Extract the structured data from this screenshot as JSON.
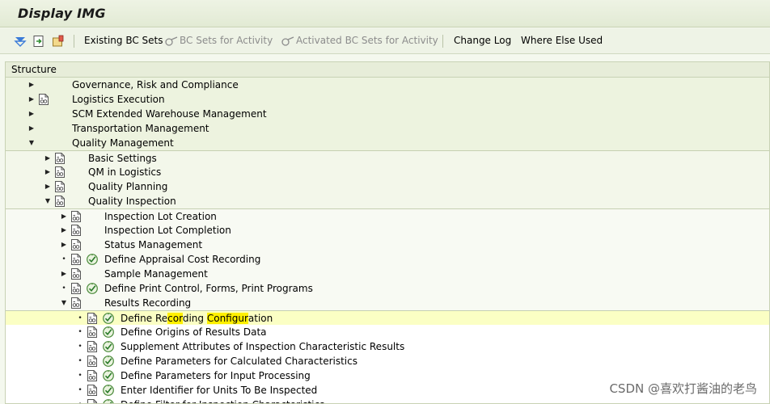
{
  "window": {
    "title": "Display IMG"
  },
  "toolbar": {
    "existing_bc_sets": "Existing BC Sets",
    "bc_sets_for_activity": "BC Sets for Activity",
    "activated_bc_sets_for_activity": "Activated BC Sets for Activity",
    "change_log": "Change Log",
    "where_else_used": "Where Else Used"
  },
  "tree": {
    "header": "Structure",
    "rows": [
      {
        "label": "Governance, Risk and Compliance"
      },
      {
        "label": "Logistics Execution"
      },
      {
        "label": "SCM Extended Warehouse Management"
      },
      {
        "label": "Transportation Management"
      },
      {
        "label": "Quality Management"
      },
      {
        "label": "Basic Settings"
      },
      {
        "label": "QM in Logistics"
      },
      {
        "label": "Quality Planning"
      },
      {
        "label": "Quality Inspection"
      },
      {
        "label": "Inspection Lot Creation"
      },
      {
        "label": "Inspection Lot Completion"
      },
      {
        "label": "Status Management"
      },
      {
        "label": "Define Appraisal Cost Recording"
      },
      {
        "label": "Sample Management"
      },
      {
        "label": "Define Print Control, Forms, Print Programs"
      },
      {
        "label": "Results Recording"
      },
      {
        "label_parts": [
          "Define Re",
          "cor",
          "ding ",
          "Configur",
          "ation"
        ]
      },
      {
        "label": "Define Origins of Results Data"
      },
      {
        "label": "Supplement Attributes of Inspection Characteristic Results"
      },
      {
        "label": "Define Parameters for Calculated Characteristics"
      },
      {
        "label": "Define Parameters for Input Processing"
      },
      {
        "label": "Enter Identifier for Units To Be Inspected"
      },
      {
        "label": "Define Filter for Inspection Characteristics"
      }
    ]
  },
  "watermark": "CSDN @喜欢打酱油的老鸟"
}
